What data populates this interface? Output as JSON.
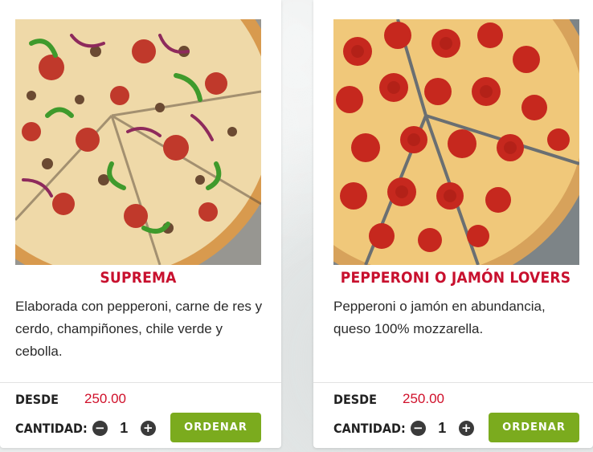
{
  "products": [
    {
      "name": "SUPREMA",
      "description": "Elaborada con pepperoni, carne de res y cerdo, champiñones, chile verde y cebolla.",
      "price_label": "DESDE",
      "price": "250.00",
      "quantity_label": "CANTIDAD:",
      "quantity": "1",
      "decrement_symbol": "−",
      "increment_symbol": "+",
      "order_label": "ORDENAR",
      "image_icon": "supreme-pizza-image"
    },
    {
      "name": "PEPPERONI O JAMÓN LOVERS",
      "description": "Pepperoni o jamón en abundancia, queso 100% mozzarella.",
      "price_label": "DESDE",
      "price": "250.00",
      "quantity_label": "CANTIDAD:",
      "quantity": "1",
      "decrement_symbol": "−",
      "increment_symbol": "+",
      "order_label": "ORDENAR",
      "image_icon": "pepperoni-pizza-image"
    }
  ],
  "colors": {
    "title": "#c8102e",
    "price": "#d0102a",
    "order_button": "#7bab1e",
    "qty_button": "#3a3a3a"
  }
}
